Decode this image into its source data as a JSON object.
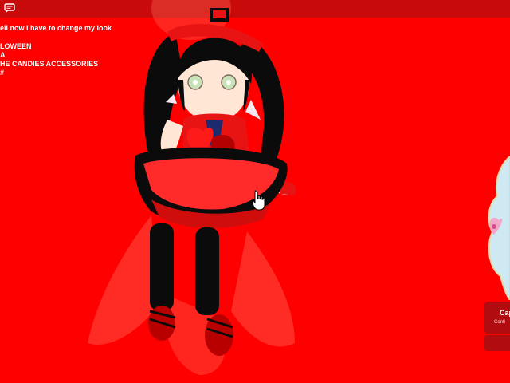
{
  "chat": {
    "lines": [
      "ell now I have to change my look",
      "",
      "LOWEEN",
      "A",
      "HE CANDIES ACCESSORIES",
      "#"
    ]
  },
  "cap_button": {
    "label": "Cap",
    "sub_label": "Confi"
  },
  "colors": {
    "background": "#ff0000",
    "topbar": "#c80a0a",
    "button": "#b10d10",
    "hair": "#0b0b0b",
    "dress_red": "#f21d1d",
    "dress_navy": "#1d2a6e",
    "skin": "#ffe6d5",
    "card_blue": "#cfe9f2",
    "card_pink": "#f2a7c7"
  },
  "icons": {
    "chat": "chat-icon",
    "cursor": "hand-pointer-icon"
  }
}
